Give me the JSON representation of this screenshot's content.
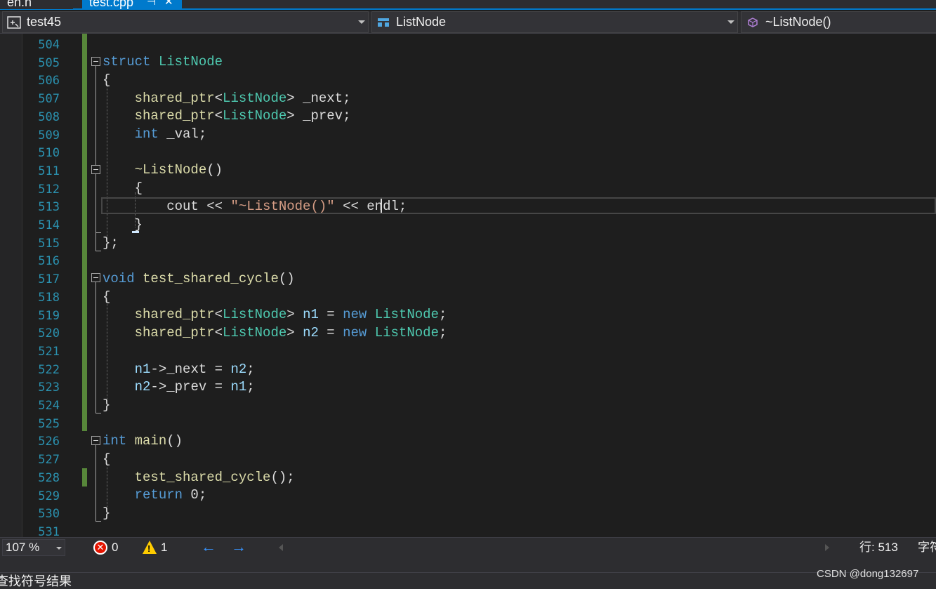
{
  "tabs": [
    {
      "label": "en.h",
      "active": false
    },
    {
      "label": "test.cpp",
      "active": true,
      "pin_glyph": "⊣",
      "close_glyph": "✕"
    }
  ],
  "navbar": {
    "project": "test45",
    "scope": "ListNode",
    "member": "~ListNode()"
  },
  "editor": {
    "line_numbers": [
      "504",
      "505",
      "506",
      "507",
      "508",
      "509",
      "510",
      "511",
      "512",
      "513",
      "514",
      "515",
      "516",
      "517",
      "518",
      "519",
      "520",
      "521",
      "522",
      "523",
      "524",
      "525",
      "526",
      "527",
      "528",
      "529",
      "530",
      "531"
    ]
  },
  "code": {
    "l505": {
      "kw": "struct",
      "ty": "ListNode"
    },
    "l506": "{",
    "l507": {
      "fn": "shared_ptr",
      "lt": "<",
      "ty": "ListNode",
      "gt": ">",
      "rest": " _next;"
    },
    "l508": {
      "fn": "shared_ptr",
      "lt": "<",
      "ty": "ListNode",
      "gt": ">",
      "rest": " _prev;"
    },
    "l509": {
      "kw": "int",
      "rest": " _val;"
    },
    "l511": {
      "tilde": "~",
      "fn": "ListNode",
      "rest": "()"
    },
    "l512": "{",
    "l513": {
      "id": "cout",
      "op1": " << ",
      "str": "\"~ListNode()\"",
      "op2": " << ",
      "id2": "endl",
      "rest": ";"
    },
    "l514": "}",
    "l515": "};",
    "l517": {
      "kw": "void",
      "fn": "test_shared_cycle",
      "rest": "()"
    },
    "l518": "{",
    "l519": {
      "fn": "shared_ptr",
      "lt": "<",
      "ty": "ListNode",
      "gt": ">",
      "var": "n1",
      "eq": " = ",
      "kw": "new",
      "ty2": "ListNode",
      "rest": ";"
    },
    "l520": {
      "fn": "shared_ptr",
      "lt": "<",
      "ty": "ListNode",
      "gt": ">",
      "var": "n2",
      "eq": " = ",
      "kw": "new",
      "ty2": "ListNode",
      "rest": ";"
    },
    "l522": {
      "var": "n1",
      "arrow": "->",
      "mem": "_next",
      "eq": " = ",
      "var2": "n2",
      "rest": ";"
    },
    "l523": {
      "var": "n2",
      "arrow": "->",
      "mem": "_prev",
      "eq": " = ",
      "var2": "n1",
      "rest": ";"
    },
    "l524": "}",
    "l526": {
      "kw": "int",
      "fn": "main",
      "rest": "()"
    },
    "l527": "{",
    "l528": {
      "fn": "test_shared_cycle",
      "rest": "();"
    },
    "l529": {
      "kw": "return",
      "rest": " 0;"
    },
    "l530": "}"
  },
  "statusbar": {
    "zoom": "107 %",
    "errors": "0",
    "warnings": "1",
    "error_glyph": "✕",
    "warning_glyph": "!",
    "back_glyph": "←",
    "forward_glyph": "→",
    "row": "行: 513",
    "col": "字符"
  },
  "bottom_panel": {
    "label": "查找符号结果"
  },
  "watermark": "CSDN @dong132697",
  "colors": {
    "keyword": "#569cd6",
    "type": "#4ec9b0",
    "function": "#dcdcaa",
    "string": "#d69d85",
    "line_number": "#2b91af",
    "change_bar": "#57873a",
    "accent": "#007acc"
  }
}
